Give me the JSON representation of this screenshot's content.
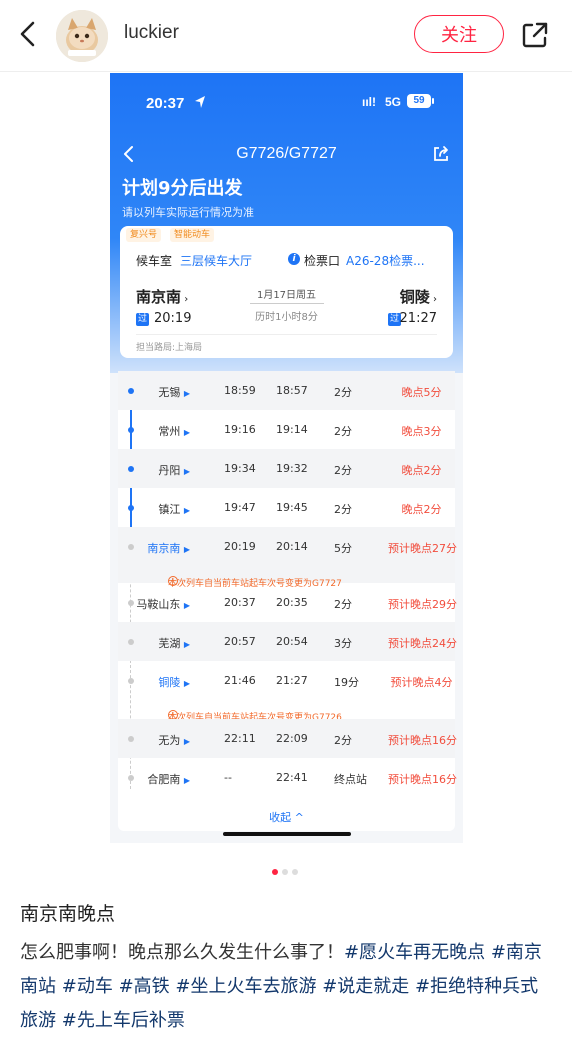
{
  "topbar": {
    "username": "luckier",
    "follow_label": "关注"
  },
  "screenshot": {
    "status": {
      "time": "20:37",
      "signal": "ııl!",
      "network": "5G",
      "battery": "59"
    },
    "train_no": "G7726/G7727",
    "depart_title": "计划9分后出发",
    "depart_sub": "请以列车实际运行情况为准",
    "card": {
      "tags": [
        "复兴号",
        "智能动车"
      ],
      "wait_label": "候车室",
      "wait_value": "三层候车大厅",
      "gate_label": "检票口",
      "gate_value": "A26-28检票...",
      "from_station": "南京南",
      "to_station": "铜陵",
      "date": "1月17日周五",
      "duration": "历时1小时8分",
      "pass_badge": "过",
      "from_time": "20:19",
      "to_time": "21:27",
      "bureau": "担当路局:上海局"
    },
    "stops": [
      {
        "name": "无锡",
        "arr": "18:59",
        "dep": "18:57",
        "stay": "2分",
        "status": "晚点5分"
      },
      {
        "name": "常州",
        "arr": "19:16",
        "dep": "19:14",
        "stay": "2分",
        "status": "晚点3分"
      },
      {
        "name": "丹阳",
        "arr": "19:34",
        "dep": "19:32",
        "stay": "2分",
        "status": "晚点2分"
      },
      {
        "name": "镇江",
        "arr": "19:47",
        "dep": "19:45",
        "stay": "2分",
        "status": "晚点2分"
      },
      {
        "name": "南京南",
        "arr": "20:19",
        "dep": "20:14",
        "stay": "5分",
        "status": "预计晚点27分"
      },
      {
        "name": "马鞍山东",
        "arr": "20:37",
        "dep": "20:35",
        "stay": "2分",
        "status": "预计晚点29分"
      },
      {
        "name": "芜湖",
        "arr": "20:57",
        "dep": "20:54",
        "stay": "3分",
        "status": "预计晚点24分"
      },
      {
        "name": "铜陵",
        "arr": "21:46",
        "dep": "21:27",
        "stay": "19分",
        "status": "预计晚点4分"
      },
      {
        "name": "无为",
        "arr": "22:11",
        "dep": "22:09",
        "stay": "2分",
        "status": "预计晚点16分"
      },
      {
        "name": "合肥南",
        "arr": "--",
        "dep": "22:41",
        "stay": "终点站",
        "status": "预计晚点16分"
      }
    ],
    "notice_1": "本次列车自当前车站起车次号变更为G7727",
    "notice_2": "本次列车自当前车站起车次号变更为G7726",
    "collapse_label": "收起 ^"
  },
  "note": {
    "title": "南京南晚点",
    "text": "怎么肥事啊！晚点那么久发生什么事了！",
    "hashtags": [
      "#愿火车再无晚点",
      "#南京南站",
      "#动车",
      "#高铁",
      "#坐上火车去旅游",
      "#说走就走",
      "#拒绝特种兵式旅游",
      "#先上车后补票"
    ]
  },
  "colors": {
    "brand_red": "#ff2442",
    "app_blue": "#1e74f5",
    "delay_red": "#f24d3d",
    "hashtag": "#13386c"
  }
}
